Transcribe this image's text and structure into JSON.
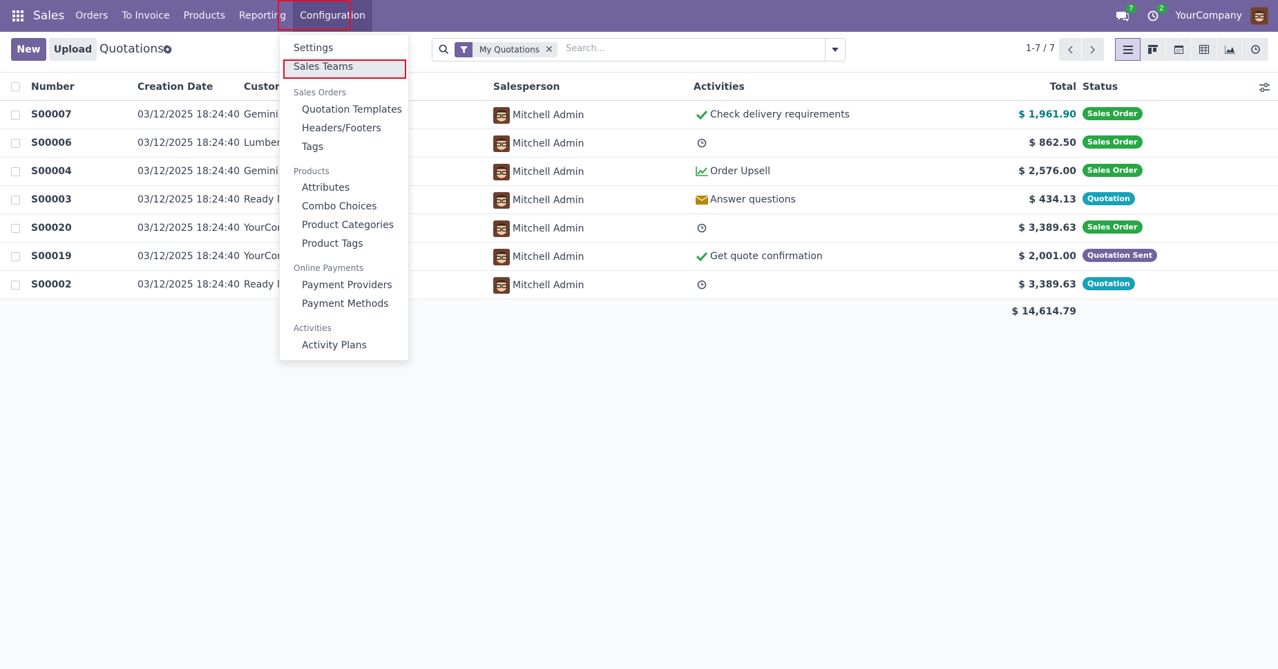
{
  "navbar": {
    "brand": "Sales",
    "items": [
      "Orders",
      "To Invoice",
      "Products",
      "Reporting",
      "Configuration"
    ],
    "messages_count": "7",
    "activities_count": "2",
    "company": "YourCompany"
  },
  "control": {
    "new_label": "New",
    "upload_label": "Upload",
    "title": "Quotations",
    "facet_label": "My Quotations",
    "search_placeholder": "Search...",
    "pager": "1-7 / 7"
  },
  "table": {
    "headers": {
      "number": "Number",
      "creation_date": "Creation Date",
      "customer": "Custom",
      "salesperson": "Salesperson",
      "activities": "Activities",
      "total": "Total",
      "status": "Status"
    },
    "rows": [
      {
        "number": "S00007",
        "date": "03/12/2025 18:24:40",
        "customer": "Gemini I",
        "salesperson": "Mitchell Admin",
        "activity": "Check delivery requirements",
        "activity_icon": "check-icon",
        "total": "$ 1,961.90",
        "status": "Sales Order"
      },
      {
        "number": "S00006",
        "date": "03/12/2025 18:24:40",
        "customer": "Lumber",
        "salesperson": "Mitchell Admin",
        "activity": "",
        "activity_icon": "clock-icon",
        "total": "$ 862.50",
        "status": "Sales Order"
      },
      {
        "number": "S00004",
        "date": "03/12/2025 18:24:40",
        "customer": "Gemini I",
        "salesperson": "Mitchell Admin",
        "activity": "Order Upsell",
        "activity_icon": "chart-icon",
        "total": "$ 2,576.00",
        "status": "Sales Order"
      },
      {
        "number": "S00003",
        "date": "03/12/2025 18:24:40",
        "customer": "Ready M",
        "salesperson": "Mitchell Admin",
        "activity": "Answer questions",
        "activity_icon": "envelope-icon",
        "total": "$ 434.13",
        "status": "Quotation"
      },
      {
        "number": "S00020",
        "date": "03/12/2025 18:24:40",
        "customer": "YourCor",
        "salesperson": "Mitchell Admin",
        "activity": "",
        "activity_icon": "clock-icon",
        "total": "$ 3,389.63",
        "status": "Sales Order"
      },
      {
        "number": "S00019",
        "date": "03/12/2025 18:24:40",
        "customer": "YourCor",
        "salesperson": "Mitchell Admin",
        "activity": "Get quote confirmation",
        "activity_icon": "check-icon",
        "total": "$ 2,001.00",
        "status": "Quotation Sent"
      },
      {
        "number": "S00002",
        "date": "03/12/2025 18:24:40",
        "customer": "Ready M",
        "salesperson": "Mitchell Admin",
        "activity": "",
        "activity_icon": "clock-icon",
        "total": "$ 3,389.63",
        "status": "Quotation"
      }
    ],
    "sum_total": "$ 14,614.79"
  },
  "status_colors": {
    "Sales Order": "#28a745",
    "Quotation": "#17a2b8",
    "Quotation Sent": "#71639e"
  },
  "menu": {
    "settings": "Settings",
    "sales_teams": "Sales Teams",
    "sections": [
      {
        "title": "Sales Orders",
        "items": [
          "Quotation Templates",
          "Headers/Footers",
          "Tags"
        ]
      },
      {
        "title": "Products",
        "items": [
          "Attributes",
          "Combo Choices",
          "Product Categories",
          "Product Tags"
        ]
      },
      {
        "title": "Online Payments",
        "items": [
          "Payment Providers",
          "Payment Methods"
        ]
      },
      {
        "title": "Activities",
        "items": [
          "Activity Plans"
        ]
      }
    ]
  }
}
